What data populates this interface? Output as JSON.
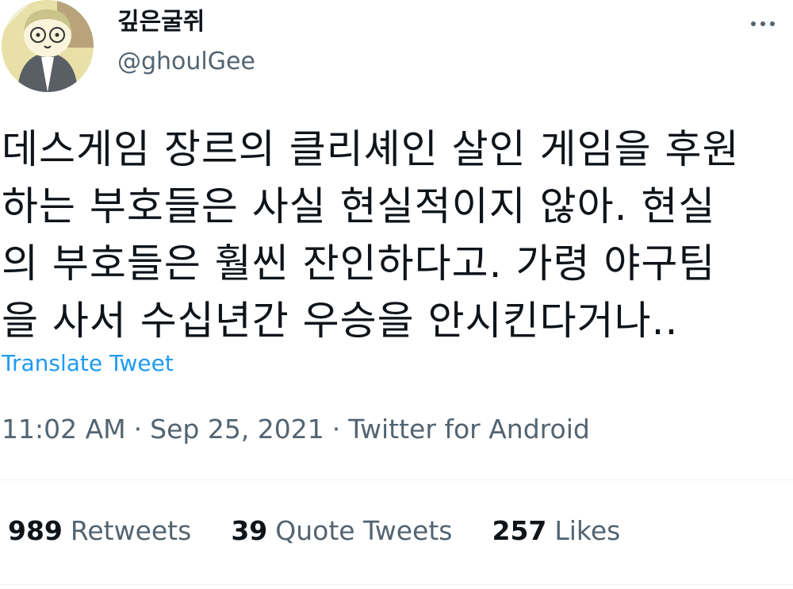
{
  "author": {
    "display_name": "깊은굴쥐",
    "handle": "@ghoulGee"
  },
  "tweet": {
    "text_lines": [
      "데스게임 장르의 클리셰인 살인 게임을 후원",
      "하는 부호들은 사실 현실적이지 않아. 현실",
      "의 부호들은 훨씬 잔인하다고. 가령 야구팀",
      "을 사서 수십년간 우승을 안시킨다거나.."
    ],
    "translate_label": "Translate Tweet"
  },
  "meta": {
    "time": "11:02 AM",
    "separator": "·",
    "date": "Sep 25, 2021",
    "source": "Twitter for Android"
  },
  "stats": {
    "retweets_count": "989",
    "retweets_label": "Retweets",
    "quotes_count": "39",
    "quotes_label": "Quote Tweets",
    "likes_count": "257",
    "likes_label": "Likes"
  },
  "colors": {
    "link": "#1d9bf0",
    "secondary_text": "#536471",
    "primary_text": "#0f1419"
  },
  "icons": {
    "more": "more-horizontal-icon"
  }
}
